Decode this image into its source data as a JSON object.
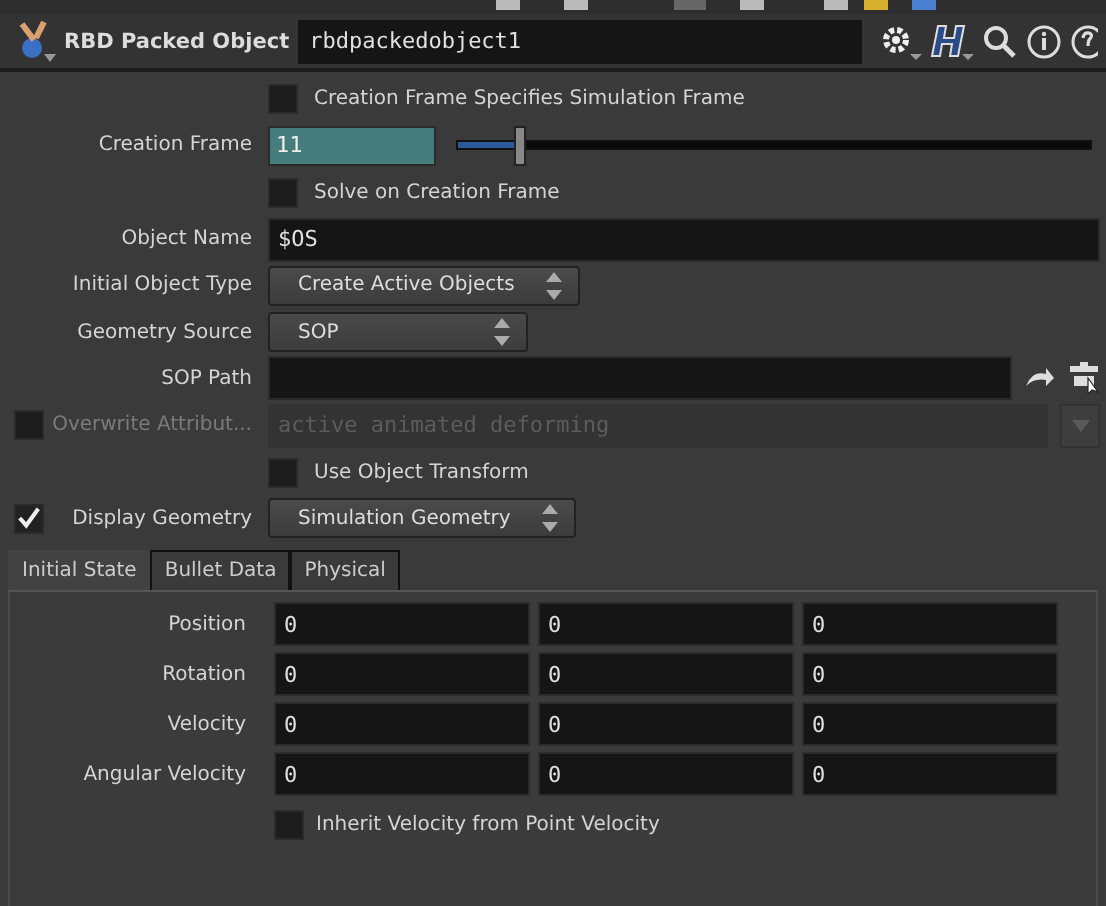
{
  "node": {
    "type_label": "RBD Packed Object",
    "name": "rbdpackedobject1"
  },
  "params": [
    {
      "kind": "toggle",
      "label": "Creation Frame Specifies Simulation Frame",
      "checked": false
    },
    {
      "kind": "slider",
      "label": "Creation Frame",
      "value": "11",
      "level": 0.1
    },
    {
      "kind": "toggle",
      "label": "Solve on Creation Frame",
      "checked": false
    },
    {
      "kind": "string",
      "label": "Object Name",
      "value": "$OS",
      "enabled": true
    },
    {
      "kind": "menu",
      "label": "Initial Object Type",
      "value": "Create Active Objects"
    },
    {
      "kind": "menu",
      "label": "Geometry Source",
      "value": "SOP"
    },
    {
      "kind": "path",
      "label": "SOP Path"
    },
    {
      "kind": "string",
      "label": "Overwrite Attribut...",
      "value": "active animated deforming",
      "enabled": false,
      "checked": false
    },
    {
      "kind": "toggle",
      "label": "Use Object Transform",
      "checked": false
    },
    {
      "kind": "menu",
      "label": "Display Geometry",
      "value": "Simulation Geometry",
      "checked": true
    }
  ],
  "tabs": [
    {
      "label": "Initial State",
      "selected": true
    },
    {
      "label": "Bullet Data",
      "selected": false
    },
    {
      "label": "Physical",
      "selected": false
    }
  ],
  "vectors": [
    {
      "label": "Position",
      "values": [
        "0",
        "0",
        "0"
      ]
    },
    {
      "label": "Rotation",
      "values": [
        "0",
        "0",
        "0"
      ]
    },
    {
      "label": "Velocity",
      "values": [
        "0",
        "0",
        "0"
      ]
    },
    {
      "label": "Angular Velocity",
      "values": [
        "0",
        "0",
        "0"
      ]
    }
  ],
  "inherit": {
    "label": "Inherit Velocity from Point Velocity",
    "checked": false
  }
}
